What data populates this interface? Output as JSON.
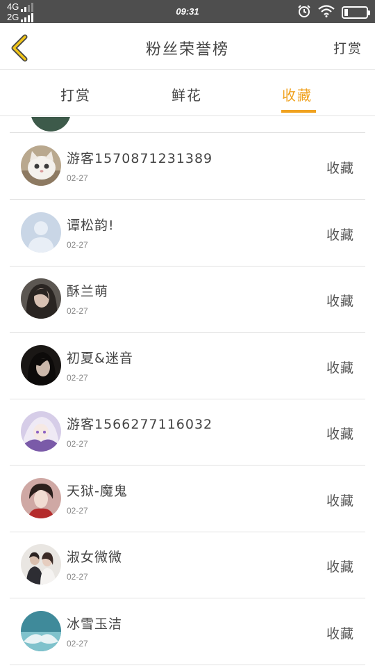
{
  "status_bar": {
    "net_top": "4G",
    "net_bottom": "2G",
    "time": "09:31"
  },
  "header": {
    "title": "粉丝荣誉榜",
    "action_label": "打赏"
  },
  "tabs": [
    {
      "label": "打赏",
      "active": false
    },
    {
      "label": "鲜花",
      "active": false
    },
    {
      "label": "收藏",
      "active": true
    }
  ],
  "colors": {
    "accent": "#f0a21f",
    "status_bar_bg": "#4e4e4e",
    "text": "#444444",
    "divider": "#e2e2e2"
  },
  "list": [
    {
      "name": "游客1570871231389",
      "date": "02-27",
      "action": "收藏",
      "avatar": "cat-avatar"
    },
    {
      "name": "谭松韵!",
      "date": "02-27",
      "action": "收藏",
      "avatar": "default-user-avatar"
    },
    {
      "name": "酥兰萌",
      "date": "02-27",
      "action": "收藏",
      "avatar": "portrait-avatar"
    },
    {
      "name": "初夏&迷音",
      "date": "02-27",
      "action": "收藏",
      "avatar": "portrait-avatar"
    },
    {
      "name": "游客1566277116032",
      "date": "02-27",
      "action": "收藏",
      "avatar": "anime-avatar"
    },
    {
      "name": "天狱-魔鬼",
      "date": "02-27",
      "action": "收藏",
      "avatar": "portrait-avatar"
    },
    {
      "name": "淑女微微",
      "date": "02-27",
      "action": "收藏",
      "avatar": "couple-avatar"
    },
    {
      "name": "冰雪玉洁",
      "date": "02-27",
      "action": "收藏",
      "avatar": "hands-avatar"
    }
  ]
}
